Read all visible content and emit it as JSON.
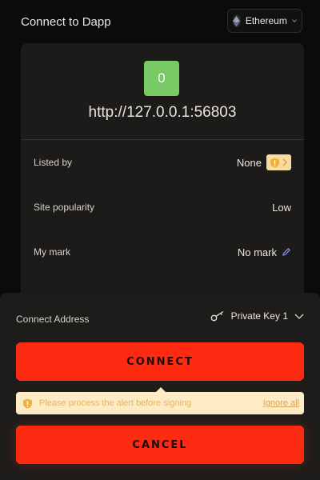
{
  "header": {
    "title": "Connect to Dapp",
    "chain": {
      "label": "Ethereum",
      "icon": "ethereum-icon"
    }
  },
  "site": {
    "icon_letter": "0",
    "icon_color": "#79c965",
    "url": "http://127.0.0.1:56803"
  },
  "details": [
    {
      "label": "Listed by",
      "value": "None"
    },
    {
      "label": "Site popularity",
      "value": "Low"
    },
    {
      "label": "My mark",
      "value": "No mark"
    }
  ],
  "connect": {
    "address_label": "Connect Address",
    "address_value": "Private Key 1",
    "connect_label": "CONNECT",
    "cancel_label": "CANCEL",
    "alert_text": "Please process the alert before signing",
    "ignore_label": "Ignore all"
  },
  "colors": {
    "accent": "#ff2a12",
    "warning_bg": "#fdebc5",
    "warning_text": "#e9b35a"
  }
}
